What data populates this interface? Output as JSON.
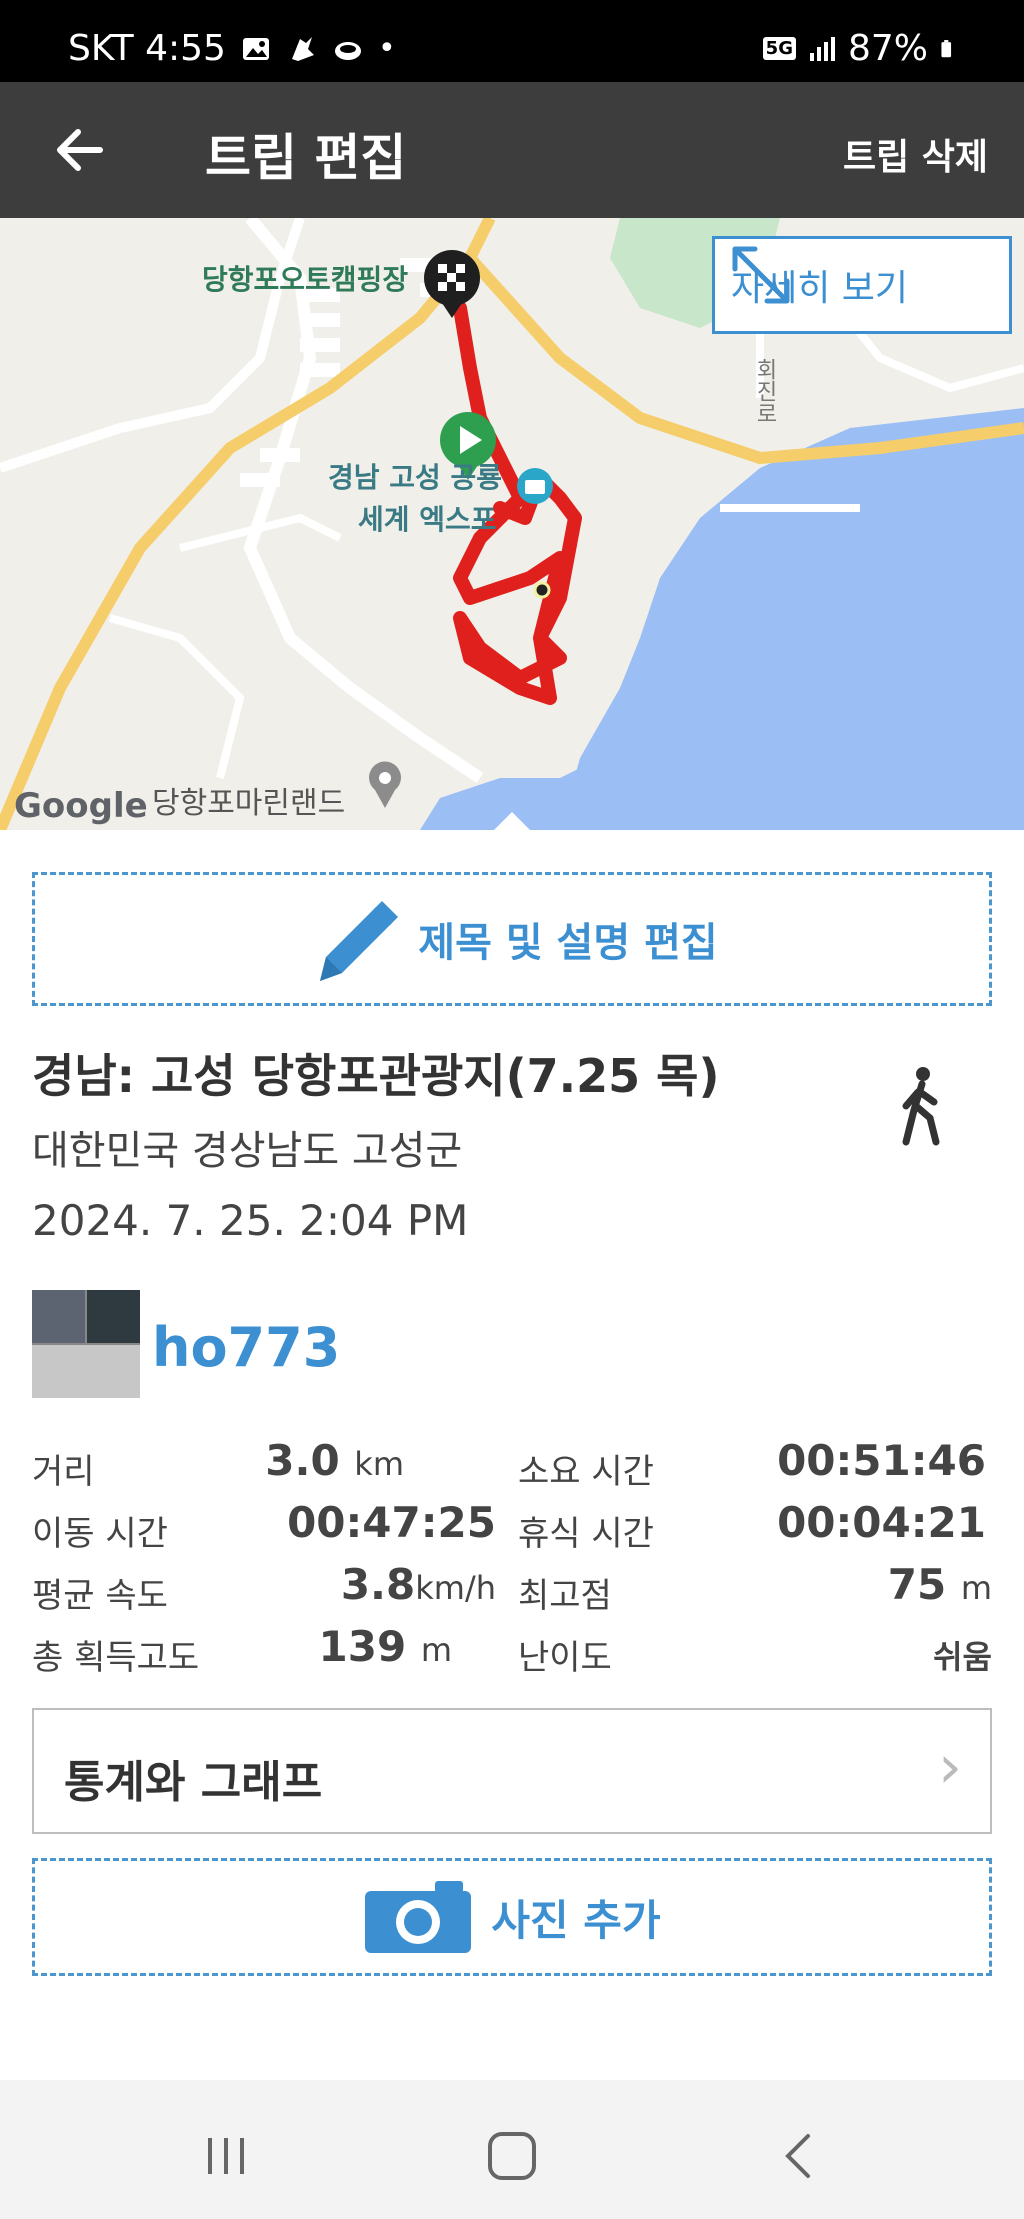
{
  "status_bar": {
    "carrier_time": "SKT 4:55",
    "network": "5G",
    "battery": "87%"
  },
  "app_bar": {
    "title": "트립 편집",
    "delete_label": "트립 삭제"
  },
  "map": {
    "detail_label": "자세히 보기",
    "place_camping": "당항포오토캠핑장",
    "place_expo_line1": "경남 고성 공룡",
    "place_expo_line2": "세계 엑스포",
    "place_marina": "당항포마린랜드",
    "road_label": "회진로",
    "attribution": "Google",
    "colors": {
      "track": "#e0201c",
      "water": "#9bbff4",
      "road": "#f5cd6b"
    }
  },
  "edit_title_label": "제목 및 설명 편집",
  "trip": {
    "title": "경남: 고성 당항포관광지(7.25 목)",
    "location": "대한민국 경상남도 고성군",
    "datetime": "2024. 7. 25. 2:04 PM",
    "activity_icon": "walking-icon"
  },
  "user": {
    "name": "ho773"
  },
  "stats": {
    "distance_label": "거리",
    "distance_value": "3.0",
    "distance_unit": "km",
    "total_time_label": "소요 시간",
    "total_time_value": "00:51:46",
    "moving_time_label": "이동 시간",
    "moving_time_value": "00:47:25",
    "rest_time_label": "휴식 시간",
    "rest_time_value": "00:04:21",
    "avg_speed_label": "평균 속도",
    "avg_speed_value": "3.8",
    "avg_speed_unit": "km/h",
    "max_alt_label": "최고점",
    "max_alt_value": "75",
    "max_alt_unit": "m",
    "total_gain_label": "총 획득고도",
    "total_gain_value": "139",
    "total_gain_unit": "m",
    "difficulty_label": "난이도",
    "difficulty_value": "쉬움"
  },
  "graph_label": "통계와 그래프",
  "add_photo_label": "사진 추가",
  "accent_color": "#3c8fd1"
}
